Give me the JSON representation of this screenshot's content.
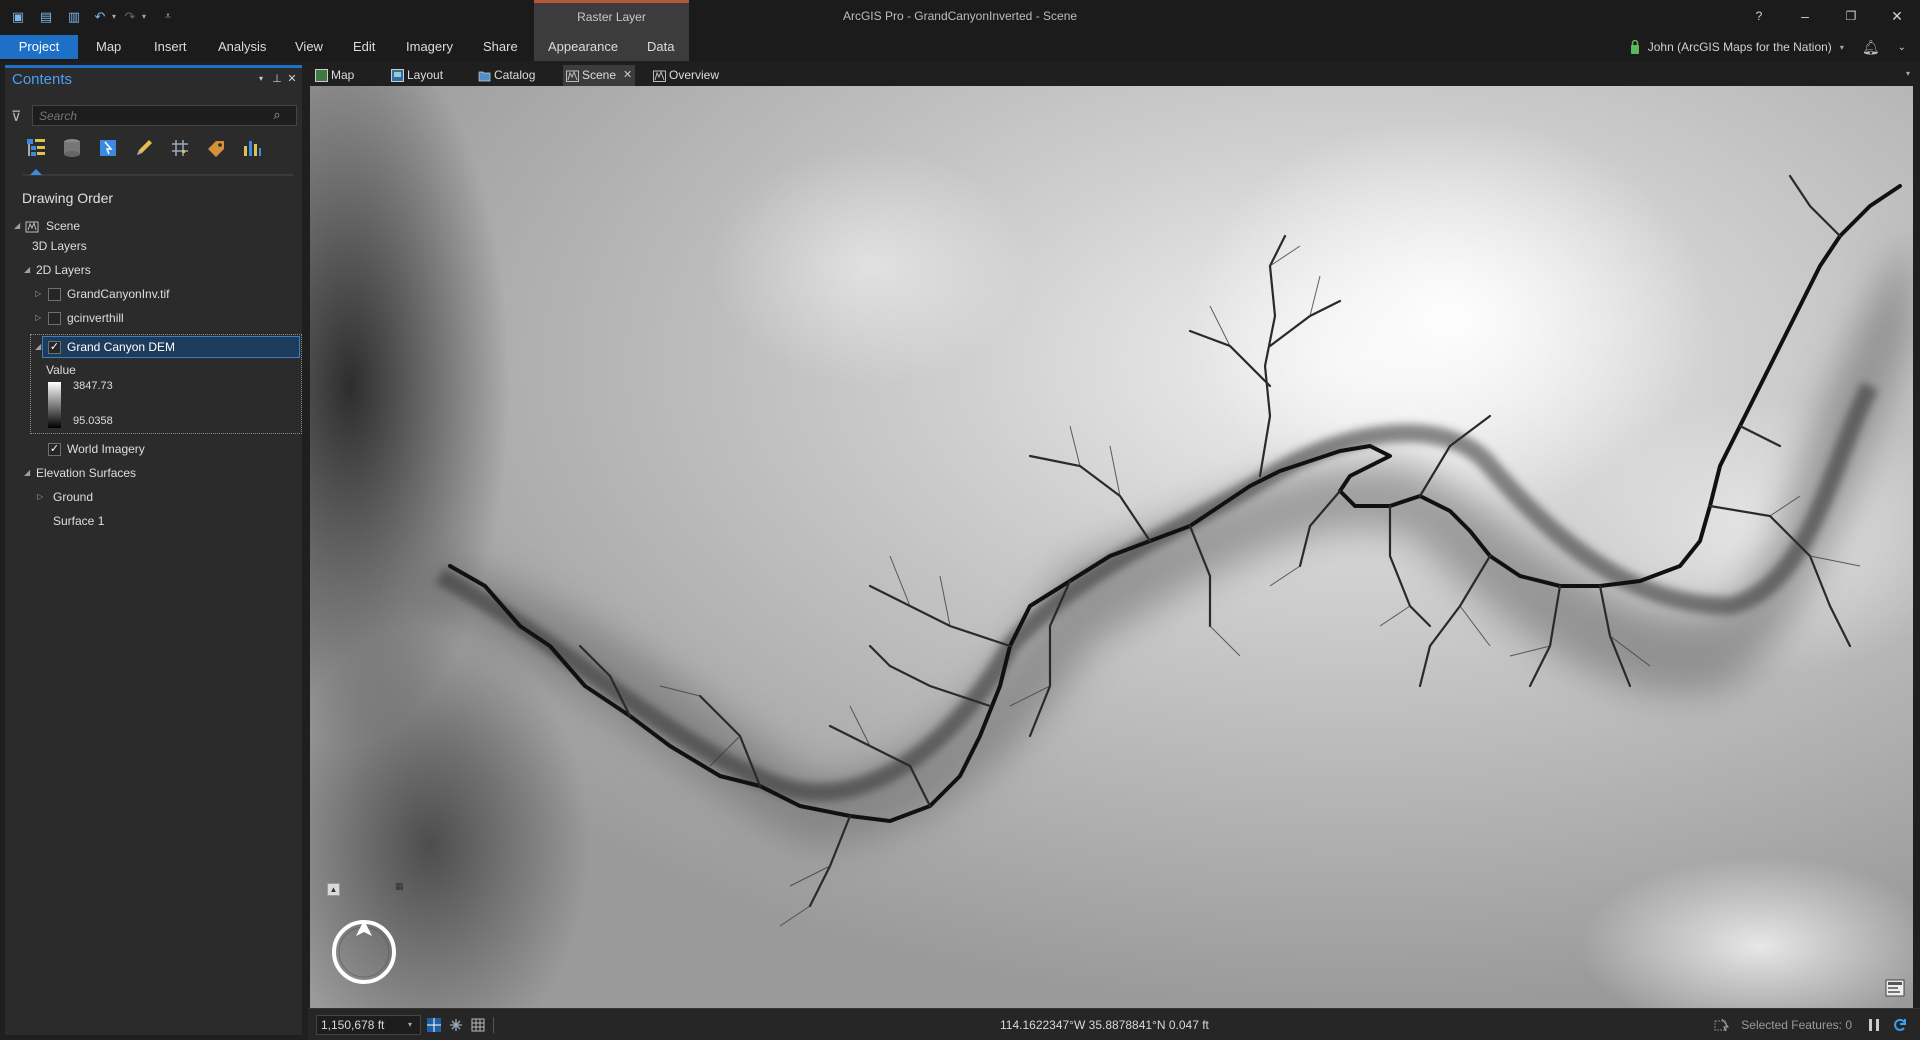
{
  "window": {
    "title": "ArcGIS Pro - GrandCanyonInverted - Scene",
    "contextual_group": "Raster Layer",
    "help": "?",
    "minimize": "–",
    "restore": "❐",
    "close": "✕"
  },
  "ribbon": {
    "tabs": [
      "Project",
      "Map",
      "Insert",
      "Analysis",
      "View",
      "Edit",
      "Imagery",
      "Share",
      "Appearance",
      "Data"
    ],
    "active_tab": "Project",
    "user": "John (ArcGIS Maps for the Nation)"
  },
  "contents": {
    "title": "Contents",
    "search_placeholder": "Search",
    "drawing_order": "Drawing Order",
    "tree": {
      "scene": "Scene",
      "layers3d": "3D Layers",
      "layers2d": "2D Layers",
      "layer1": "GrandCanyonInv.tif",
      "layer2": "gcinverthill",
      "layer3": "Grand Canyon DEM",
      "legend_title": "Value",
      "legend_max": "3847.73",
      "legend_min": "95.0358",
      "layer4": "World Imagery",
      "elevation": "Elevation Surfaces",
      "ground": "Ground",
      "surface1": "Surface 1"
    },
    "checks": {
      "layer1": false,
      "layer2": false,
      "layer3": true,
      "layer4": true
    }
  },
  "view_tabs": [
    "Map",
    "Layout",
    "Catalog",
    "Scene",
    "Overview"
  ],
  "active_view_tab": "Scene",
  "status": {
    "scale": "1,150,678 ft",
    "coordinates": "114.1622347°W 35.8878841°N   0.047 ft",
    "selected_features": "Selected Features: 0"
  },
  "colors": {
    "accent": "#1e6fc6",
    "contextual": "#b5573a",
    "panel": "#2b2b2b",
    "title_bar": "#1b1b1b"
  }
}
